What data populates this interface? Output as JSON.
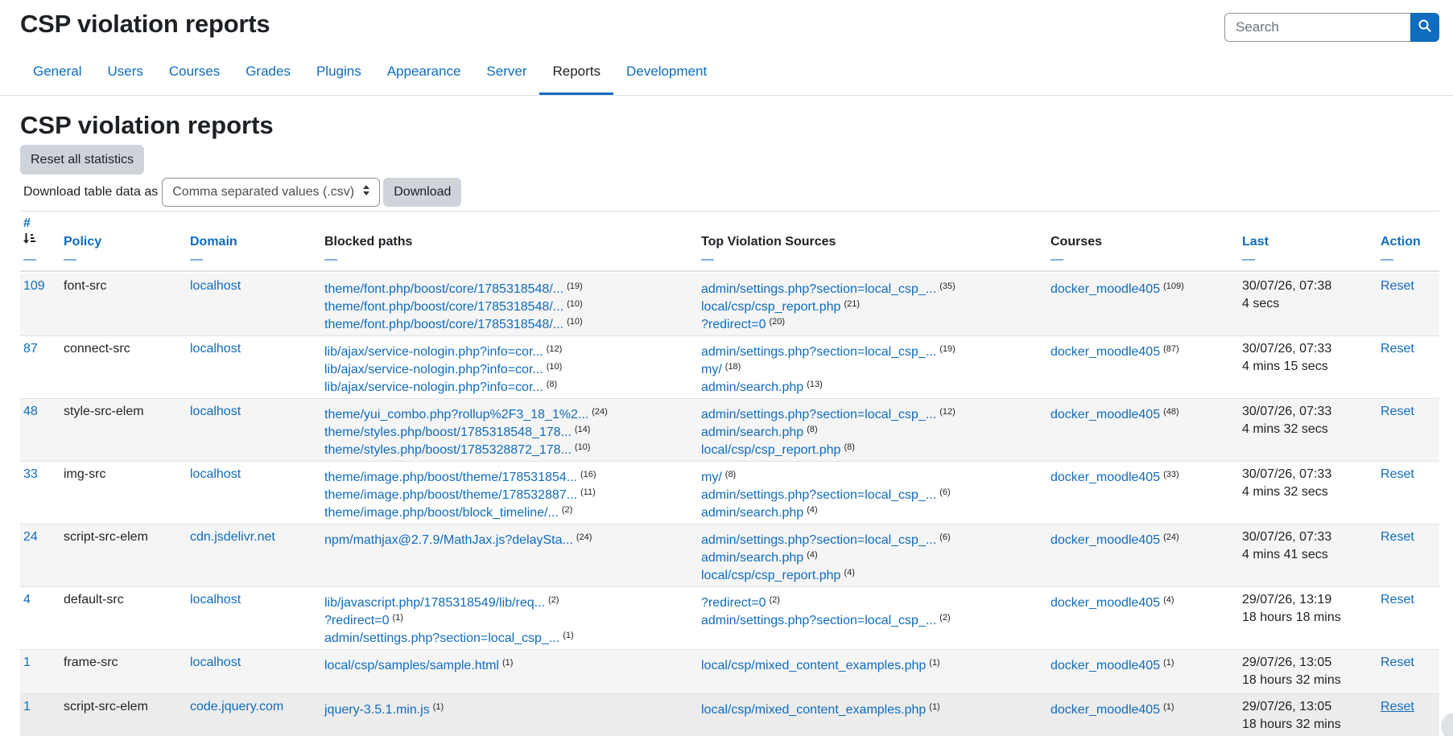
{
  "page": {
    "title": "CSP violation reports"
  },
  "search": {
    "placeholder": "Search",
    "icon": "search-icon"
  },
  "tabs": [
    {
      "label": "General",
      "active": false
    },
    {
      "label": "Users",
      "active": false
    },
    {
      "label": "Courses",
      "active": false
    },
    {
      "label": "Grades",
      "active": false
    },
    {
      "label": "Plugins",
      "active": false
    },
    {
      "label": "Appearance",
      "active": false
    },
    {
      "label": "Server",
      "active": false
    },
    {
      "label": "Reports",
      "active": true
    },
    {
      "label": "Development",
      "active": false
    }
  ],
  "section": {
    "title": "CSP violation reports",
    "reset_all_label": "Reset all statistics"
  },
  "download": {
    "label": "Download table data as",
    "selected_format": "Comma separated values (.csv)",
    "button_label": "Download"
  },
  "table": {
    "headers": {
      "hash": "#",
      "policy": "Policy",
      "domain": "Domain",
      "blocked_paths": "Blocked paths",
      "top_sources": "Top Violation Sources",
      "courses": "Courses",
      "last": "Last",
      "action": "Action",
      "collapse": "—"
    },
    "rows": [
      {
        "count": "109",
        "policy": "font-src",
        "domain": "localhost",
        "paths": [
          {
            "text": "theme/font.php/boost/core/1785318548/...",
            "n": "(19)"
          },
          {
            "text": "theme/font.php/boost/core/1785318548/...",
            "n": "(10)"
          },
          {
            "text": "theme/font.php/boost/core/1785318548/...",
            "n": "(10)"
          }
        ],
        "sources": [
          {
            "text": "admin/settings.php?section=local_csp_...",
            "n": "(35)"
          },
          {
            "text": "local/csp/csp_report.php",
            "n": "(21)"
          },
          {
            "text": "?redirect=0",
            "n": "(20)"
          }
        ],
        "course": {
          "text": "docker_moodle405",
          "n": "(109)"
        },
        "last_date": "30/07/26, 07:38",
        "last_ago": "4 secs",
        "action": "Reset"
      },
      {
        "count": "87",
        "policy": "connect-src",
        "domain": "localhost",
        "paths": [
          {
            "text": "lib/ajax/service-nologin.php?info=cor...",
            "n": "(12)"
          },
          {
            "text": "lib/ajax/service-nologin.php?info=cor...",
            "n": "(10)"
          },
          {
            "text": "lib/ajax/service-nologin.php?info=cor...",
            "n": "(8)"
          }
        ],
        "sources": [
          {
            "text": "admin/settings.php?section=local_csp_...",
            "n": "(19)"
          },
          {
            "text": "my/",
            "n": "(18)"
          },
          {
            "text": "admin/search.php",
            "n": "(13)"
          }
        ],
        "course": {
          "text": "docker_moodle405",
          "n": "(87)"
        },
        "last_date": "30/07/26, 07:33",
        "last_ago": "4 mins 15 secs",
        "action": "Reset"
      },
      {
        "count": "48",
        "policy": "style-src-elem",
        "domain": "localhost",
        "paths": [
          {
            "text": "theme/yui_combo.php?rollup%2F3_18_1%2...",
            "n": "(24)"
          },
          {
            "text": "theme/styles.php/boost/1785318548_178...",
            "n": "(14)"
          },
          {
            "text": "theme/styles.php/boost/1785328872_178...",
            "n": "(10)"
          }
        ],
        "sources": [
          {
            "text": "admin/settings.php?section=local_csp_...",
            "n": "(12)"
          },
          {
            "text": "admin/search.php",
            "n": "(8)"
          },
          {
            "text": "local/csp/csp_report.php",
            "n": "(8)"
          }
        ],
        "course": {
          "text": "docker_moodle405",
          "n": "(48)"
        },
        "last_date": "30/07/26, 07:33",
        "last_ago": "4 mins 32 secs",
        "action": "Reset"
      },
      {
        "count": "33",
        "policy": "img-src",
        "domain": "localhost",
        "paths": [
          {
            "text": "theme/image.php/boost/theme/178531854...",
            "n": "(16)"
          },
          {
            "text": "theme/image.php/boost/theme/178532887...",
            "n": "(11)"
          },
          {
            "text": "theme/image.php/boost/block_timeline/...",
            "n": "(2)"
          }
        ],
        "sources": [
          {
            "text": "my/",
            "n": "(8)"
          },
          {
            "text": "admin/settings.php?section=local_csp_...",
            "n": "(6)"
          },
          {
            "text": "admin/search.php",
            "n": "(4)"
          }
        ],
        "course": {
          "text": "docker_moodle405",
          "n": "(33)"
        },
        "last_date": "30/07/26, 07:33",
        "last_ago": "4 mins 32 secs",
        "action": "Reset"
      },
      {
        "count": "24",
        "policy": "script-src-elem",
        "domain": "cdn.jsdelivr.net",
        "paths": [
          {
            "text": "npm/mathjax@2.7.9/MathJax.js?delaySta...",
            "n": "(24)"
          }
        ],
        "sources": [
          {
            "text": "admin/settings.php?section=local_csp_...",
            "n": "(6)"
          },
          {
            "text": "admin/search.php",
            "n": "(4)"
          },
          {
            "text": "local/csp/csp_report.php",
            "n": "(4)"
          }
        ],
        "course": {
          "text": "docker_moodle405",
          "n": "(24)"
        },
        "last_date": "30/07/26, 07:33",
        "last_ago": "4 mins 41 secs",
        "action": "Reset"
      },
      {
        "count": "4",
        "policy": "default-src",
        "domain": "localhost",
        "paths": [
          {
            "text": "lib/javascript.php/1785318549/lib/req...",
            "n": "(2)"
          },
          {
            "text": "?redirect=0",
            "n": "(1)"
          },
          {
            "text": "admin/settings.php?section=local_csp_...",
            "n": "(1)"
          }
        ],
        "sources": [
          {
            "text": "?redirect=0",
            "n": "(2)"
          },
          {
            "text": "admin/settings.php?section=local_csp_...",
            "n": "(2)"
          }
        ],
        "course": {
          "text": "docker_moodle405",
          "n": "(4)"
        },
        "last_date": "29/07/26, 13:19",
        "last_ago": "18 hours 18 mins",
        "action": "Reset"
      },
      {
        "count": "1",
        "policy": "frame-src",
        "domain": "localhost",
        "paths": [
          {
            "text": "local/csp/samples/sample.html",
            "n": "(1)"
          }
        ],
        "sources": [
          {
            "text": "local/csp/mixed_content_examples.php",
            "n": "(1)"
          }
        ],
        "course": {
          "text": "docker_moodle405",
          "n": "(1)"
        },
        "last_date": "29/07/26, 13:05",
        "last_ago": "18 hours 32 mins",
        "action": "Reset"
      },
      {
        "count": "1",
        "policy": "script-src-elem",
        "domain": "code.jquery.com",
        "paths": [
          {
            "text": "jquery-3.5.1.min.js",
            "n": "(1)"
          }
        ],
        "sources": [
          {
            "text": "local/csp/mixed_content_examples.php",
            "n": "(1)"
          }
        ],
        "course": {
          "text": "docker_moodle405",
          "n": "(1)"
        },
        "last_date": "29/07/26, 13:05",
        "last_ago": "18 hours 32 mins",
        "action": "Reset"
      }
    ]
  }
}
